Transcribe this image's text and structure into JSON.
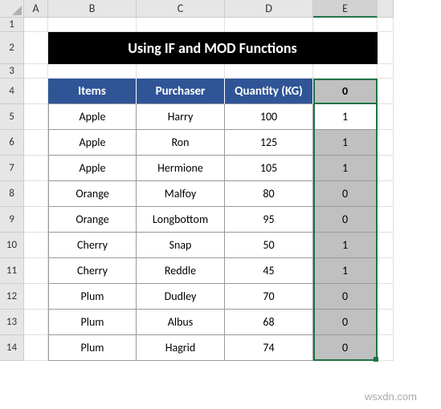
{
  "columns": [
    "A",
    "B",
    "C",
    "D",
    "E"
  ],
  "title": "Using  IF and MOD Functions",
  "headers": {
    "b": "Items",
    "c": "Purchaser",
    "d": "Quantity (KG)",
    "e": "0"
  },
  "rows": [
    {
      "item": "Apple",
      "purchaser": "Harry",
      "qty": "100",
      "e": "1",
      "shaded": false
    },
    {
      "item": "Apple",
      "purchaser": "Ron",
      "qty": "125",
      "e": "1",
      "shaded": true
    },
    {
      "item": "Apple",
      "purchaser": "Hermione",
      "qty": "105",
      "e": "1",
      "shaded": true
    },
    {
      "item": "Orange",
      "purchaser": "Malfoy",
      "qty": "80",
      "e": "0",
      "shaded": true
    },
    {
      "item": "Orange",
      "purchaser": "Longbottom",
      "qty": "95",
      "e": "0",
      "shaded": true
    },
    {
      "item": "Cherry",
      "purchaser": "Snap",
      "qty": "50",
      "e": "1",
      "shaded": true
    },
    {
      "item": "Cherry",
      "purchaser": "Reddle",
      "qty": "45",
      "e": "1",
      "shaded": true
    },
    {
      "item": "Plum",
      "purchaser": "Dudley",
      "qty": "70",
      "e": "0",
      "shaded": true
    },
    {
      "item": "Plum",
      "purchaser": "Albus",
      "qty": "68",
      "e": "0",
      "shaded": true
    },
    {
      "item": "Plum",
      "purchaser": "Hagrid",
      "qty": "74",
      "e": "0",
      "shaded": true
    }
  ],
  "watermark": "wsxdn.com",
  "selection": {
    "cell_col": "E",
    "cell_row": 4,
    "range_col": "E",
    "range_row_start": 4,
    "range_row_end": 14
  }
}
